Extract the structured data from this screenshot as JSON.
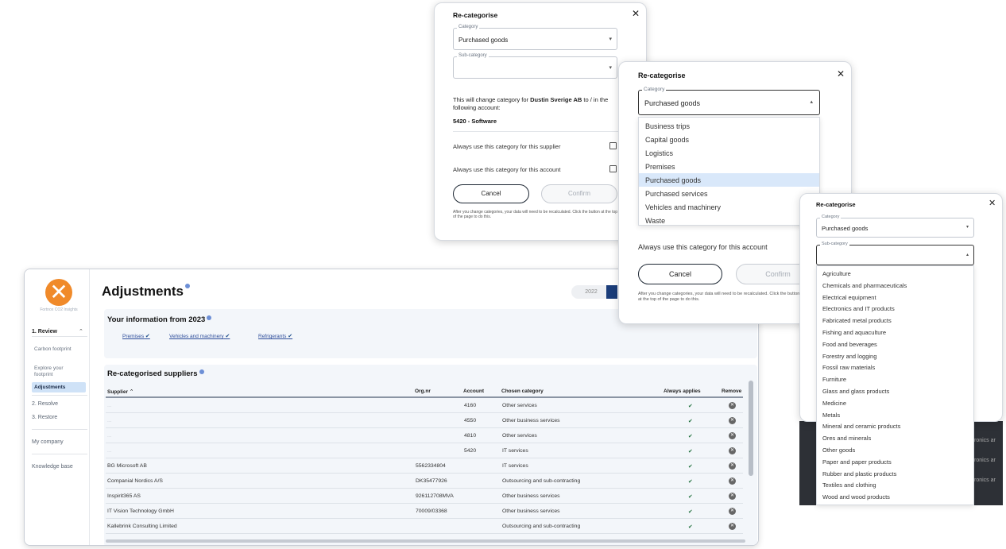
{
  "app": {
    "logo_text": "Fortnox CO2 Insights",
    "nav": {
      "review": "1. Review",
      "carbon": "Carbon footprint",
      "explore": "Explore your footprint",
      "adjustments": "Adjustments",
      "resolve": "2. Resolve",
      "restore": "3. Restore",
      "my_company": "My company",
      "knowledge": "Knowledge base"
    },
    "page_title": "Adjustments",
    "year_2022": "2022",
    "info_title": "Your information from 2023",
    "info_links": [
      "Premises",
      "Vehicles and machinery",
      "Refrigerants"
    ],
    "suppliers_title": "Re-categorised suppliers",
    "columns": {
      "supplier": "Supplier",
      "org": "Org.nr",
      "account": "Account",
      "category": "Chosen category",
      "always": "Always applies",
      "remove": "Remove"
    },
    "rows": [
      {
        "supplier": "...",
        "org": "",
        "account": "4160",
        "category": "Other services"
      },
      {
        "supplier": "...",
        "org": "",
        "account": "4550",
        "category": "Other business services"
      },
      {
        "supplier": "...",
        "org": "",
        "account": "4810",
        "category": "Other services"
      },
      {
        "supplier": "...",
        "org": "",
        "account": "5420",
        "category": "IT services"
      },
      {
        "supplier": "BG Microsoft AB",
        "org": "5562334804",
        "account": "",
        "category": "IT services"
      },
      {
        "supplier": "Companial Nordics A/S",
        "org": "DK35477926",
        "account": "",
        "category": "Outsourcing and sub-contracting"
      },
      {
        "supplier": "Inspirit365 AS",
        "org": "926112708MVA",
        "account": "",
        "category": "Other business services"
      },
      {
        "supplier": "IT Vision Technology GmbH",
        "org": "70009/03368",
        "account": "",
        "category": "Other business services"
      },
      {
        "supplier": "Kallebrink Consulting Limited",
        "org": "",
        "account": "",
        "category": "Outsourcing and sub-contracting"
      }
    ]
  },
  "modal1": {
    "title": "Re-categorise",
    "category_label": "Category",
    "category_value": "Purchased goods",
    "subcategory_label": "Sub-category",
    "change_text_a": "This will change category for",
    "supplier_name": "Dustin Sverige AB",
    "change_text_b": "to / in the following account:",
    "account": "5420 - Software",
    "always_supplier": "Always use this category for this supplier",
    "always_account": "Always use this category for this account",
    "cancel": "Cancel",
    "confirm": "Confirm",
    "note": "After you change categories, your data will need to be recalculated. Click the button at the top of the page to do this."
  },
  "modal2": {
    "title": "Re-categorise",
    "category_label": "Category",
    "category_value": "Purchased goods",
    "options": [
      "Business trips",
      "Capital goods",
      "Logistics",
      "Premises",
      "Purchased goods",
      "Purchased services",
      "Vehicles and machinery",
      "Waste"
    ],
    "selected_index": 4,
    "always_account": "Always use this category for this account",
    "cancel": "Cancel",
    "confirm": "Confirm",
    "note": "After you change categories, your data will need to be recalculated. Click the button at the top of the page to do this."
  },
  "modal3": {
    "title": "Re-categorise",
    "category_label": "Category",
    "category_value": "Purchased goods",
    "subcategory_label": "Sub-category",
    "options": [
      "Agriculture",
      "Chemicals and pharmaceuticals",
      "Electrical equipment",
      "Electronics and IT products",
      "Fabricated metal products",
      "Fishing and aquaculture",
      "Food and beverages",
      "Forestry and logging",
      "Fossil raw materials",
      "Furniture",
      "Glass and glass products",
      "Medicine",
      "Metals",
      "Mineral and ceramic products",
      "Ores and minerals",
      "Other goods",
      "Paper and paper products",
      "Rubber and plastic products",
      "Textiles and clothing",
      "Wood and wood products"
    ],
    "strip_text": [
      "ronics ar",
      "ronics ar",
      "ronics ar"
    ]
  }
}
